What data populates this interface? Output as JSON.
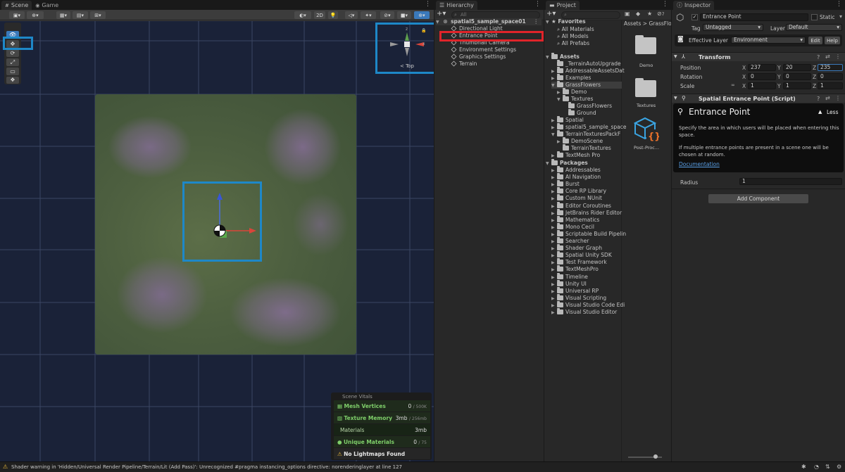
{
  "scene_panel": {
    "tabs": [
      {
        "label": "Scene",
        "icon": "hash-icon"
      },
      {
        "label": "Game",
        "icon": "gamepad-icon"
      }
    ],
    "toolbar": {
      "mode_2d": "2D"
    },
    "gizmo": {
      "view_label": "< Top",
      "axis_x": "x",
      "axis_z": "z"
    },
    "vitals": {
      "title": "Scene Vitals",
      "rows": [
        {
          "label": "Mesh Vertices",
          "value": "0",
          "limit": "/ 500K",
          "color": "#7fcf6a"
        },
        {
          "label": "Texture Memory",
          "value": "3mb",
          "limit": "/ 256mb",
          "color": "#7fcf6a"
        },
        {
          "label": "Materials",
          "value": "3mb",
          "limit": "",
          "color": "#b8d7a8"
        },
        {
          "label": "Unique Materials",
          "value": "0",
          "limit": "/ 75",
          "color": "#7fcf6a"
        },
        {
          "label": "No Lightmaps Found",
          "value": "",
          "limit": "",
          "color": "#e7e7e7"
        }
      ]
    }
  },
  "hierarchy": {
    "tab": "Hierarchy",
    "search_placeholder": "All",
    "root": "spatial5_sample_space01",
    "items": [
      "Directional Light",
      "Entrance Point",
      "Thumbnail Camera",
      "Environment Settings",
      "Graphics Settings",
      "Terrain"
    ]
  },
  "project": {
    "tab": "Project",
    "badge_count": "7",
    "favorites_label": "Favorites",
    "favorites": [
      "All Materials",
      "All Models",
      "All Prefabs"
    ],
    "assets_label": "Assets",
    "assets": [
      {
        "label": "_TerrainAutoUpgrade",
        "depth": 1,
        "arrow": ""
      },
      {
        "label": "AddressableAssetsDat",
        "depth": 1,
        "arrow": "▶"
      },
      {
        "label": "Examples",
        "depth": 1,
        "arrow": "▶"
      },
      {
        "label": "GrassFlowers",
        "depth": 1,
        "arrow": "▼"
      },
      {
        "label": "Demo",
        "depth": 2,
        "arrow": "▶"
      },
      {
        "label": "Textures",
        "depth": 2,
        "arrow": "▼"
      },
      {
        "label": "GrassFlowers",
        "depth": 3,
        "arrow": ""
      },
      {
        "label": "Ground",
        "depth": 3,
        "arrow": ""
      },
      {
        "label": "Spatial",
        "depth": 1,
        "arrow": "▶"
      },
      {
        "label": "spatial5_sample_space",
        "depth": 1,
        "arrow": "▶"
      },
      {
        "label": "TerrainTexturesPackF",
        "depth": 1,
        "arrow": "▼"
      },
      {
        "label": "DemoScene",
        "depth": 2,
        "arrow": "▶"
      },
      {
        "label": "TerrainTextures",
        "depth": 2,
        "arrow": ""
      },
      {
        "label": "TextMesh Pro",
        "depth": 1,
        "arrow": "▶"
      }
    ],
    "packages_label": "Packages",
    "packages": [
      "Addressables",
      "AI Navigation",
      "Burst",
      "Core RP Library",
      "Custom NUnit",
      "Editor Coroutines",
      "JetBrains Rider Editor",
      "Mathematics",
      "Mono Cecil",
      "Scriptable Build Pipelin",
      "Searcher",
      "Shader Graph",
      "Spatial Unity SDK",
      "Test Framework",
      "TextMeshPro",
      "Timeline",
      "Unity UI",
      "Universal RP",
      "Visual Scripting",
      "Visual Studio Code Edi",
      "Visual Studio Editor"
    ],
    "breadcrumb": "Assets > GrassFlo",
    "grid_items": [
      "Demo",
      "Textures",
      "Post-Proc..."
    ]
  },
  "inspector": {
    "tab": "Inspector",
    "object_name": "Entrance Point",
    "static_label": "Static",
    "tag_label": "Tag",
    "tag_value": "Untagged",
    "layer_label": "Layer",
    "layer_value": "Default",
    "effective_layer_label": "Effective Layer",
    "effective_layer_value": "Environment",
    "edit_label": "Edit",
    "help_label": "Help",
    "transform": {
      "title": "Transform",
      "position_label": "Position",
      "rotation_label": "Rotation",
      "scale_label": "Scale",
      "position": {
        "x": "237",
        "y": "20",
        "z": "235"
      },
      "rotation": {
        "x": "0",
        "y": "0",
        "z": "0"
      },
      "scale": {
        "x": "1",
        "y": "1",
        "z": "1"
      }
    },
    "spatial_component": {
      "title": "Spatial Entrance Point (Script)",
      "heading": "Entrance Point",
      "less_label": "Less",
      "desc1": "Specify the area in which users will be placed when entering this space.",
      "desc2": "If multiple entrance points are present in a scene one will be chosen at random.",
      "doc_link": "Documentation",
      "radius_label": "Radius",
      "radius_value": "1"
    },
    "add_component": "Add Component"
  },
  "status_bar": {
    "message": "Shader warning in 'Hidden/Universal Render Pipeline/Terrain/Lit (Add Pass)': Unrecognized #pragma instancing_options directive: norenderinglayer at line 127"
  },
  "colors": {
    "highlight_blue": "#1e88c8",
    "highlight_red": "#e0242a",
    "accent_blue": "#3a79bb"
  }
}
